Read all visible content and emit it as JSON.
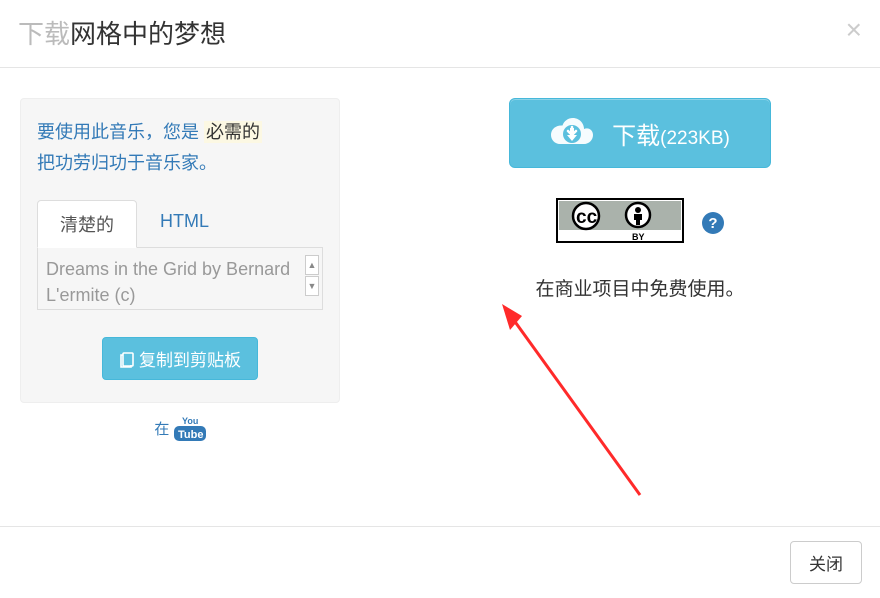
{
  "header": {
    "prefix": "下载",
    "title": "网格中的梦想"
  },
  "left": {
    "attr_line1_before": "要使用此音乐，您是",
    "attr_required": "必需的",
    "attr_line2": "把功劳归功于音乐家。",
    "tabs": {
      "plain": "清楚的",
      "html": "HTML"
    },
    "credit_text": "Dreams in the Grid by Bernard L'ermite (c)",
    "copy_label": "复制到剪贴板",
    "youtube_prefix": "在"
  },
  "right": {
    "download_label": "下载",
    "download_size": "(223KB)",
    "commercial_text": "在商业项目中免费使用。"
  },
  "footer": {
    "close_label": "关闭"
  }
}
